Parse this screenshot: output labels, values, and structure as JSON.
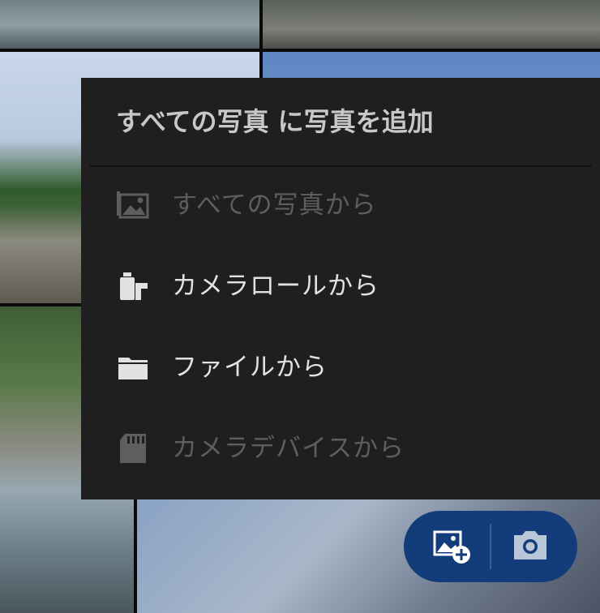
{
  "menu": {
    "title": "すべての写真 に写真を追加",
    "items": [
      {
        "label": "すべての写真から",
        "icon": "photo-icon",
        "enabled": false
      },
      {
        "label": "カメラロールから",
        "icon": "camera-roll-icon",
        "enabled": true
      },
      {
        "label": "ファイルから",
        "icon": "folder-icon",
        "enabled": true
      },
      {
        "label": "カメラデバイスから",
        "icon": "sd-card-icon",
        "enabled": false
      }
    ]
  },
  "fab": {
    "add_icon": "add-photo-icon",
    "camera_icon": "camera-icon"
  },
  "colors": {
    "menu_bg": "#1f1f1f",
    "enabled_text": "#e2e2e2",
    "disabled_text": "#5e5e5e",
    "fab_bg": "#123d7a"
  }
}
